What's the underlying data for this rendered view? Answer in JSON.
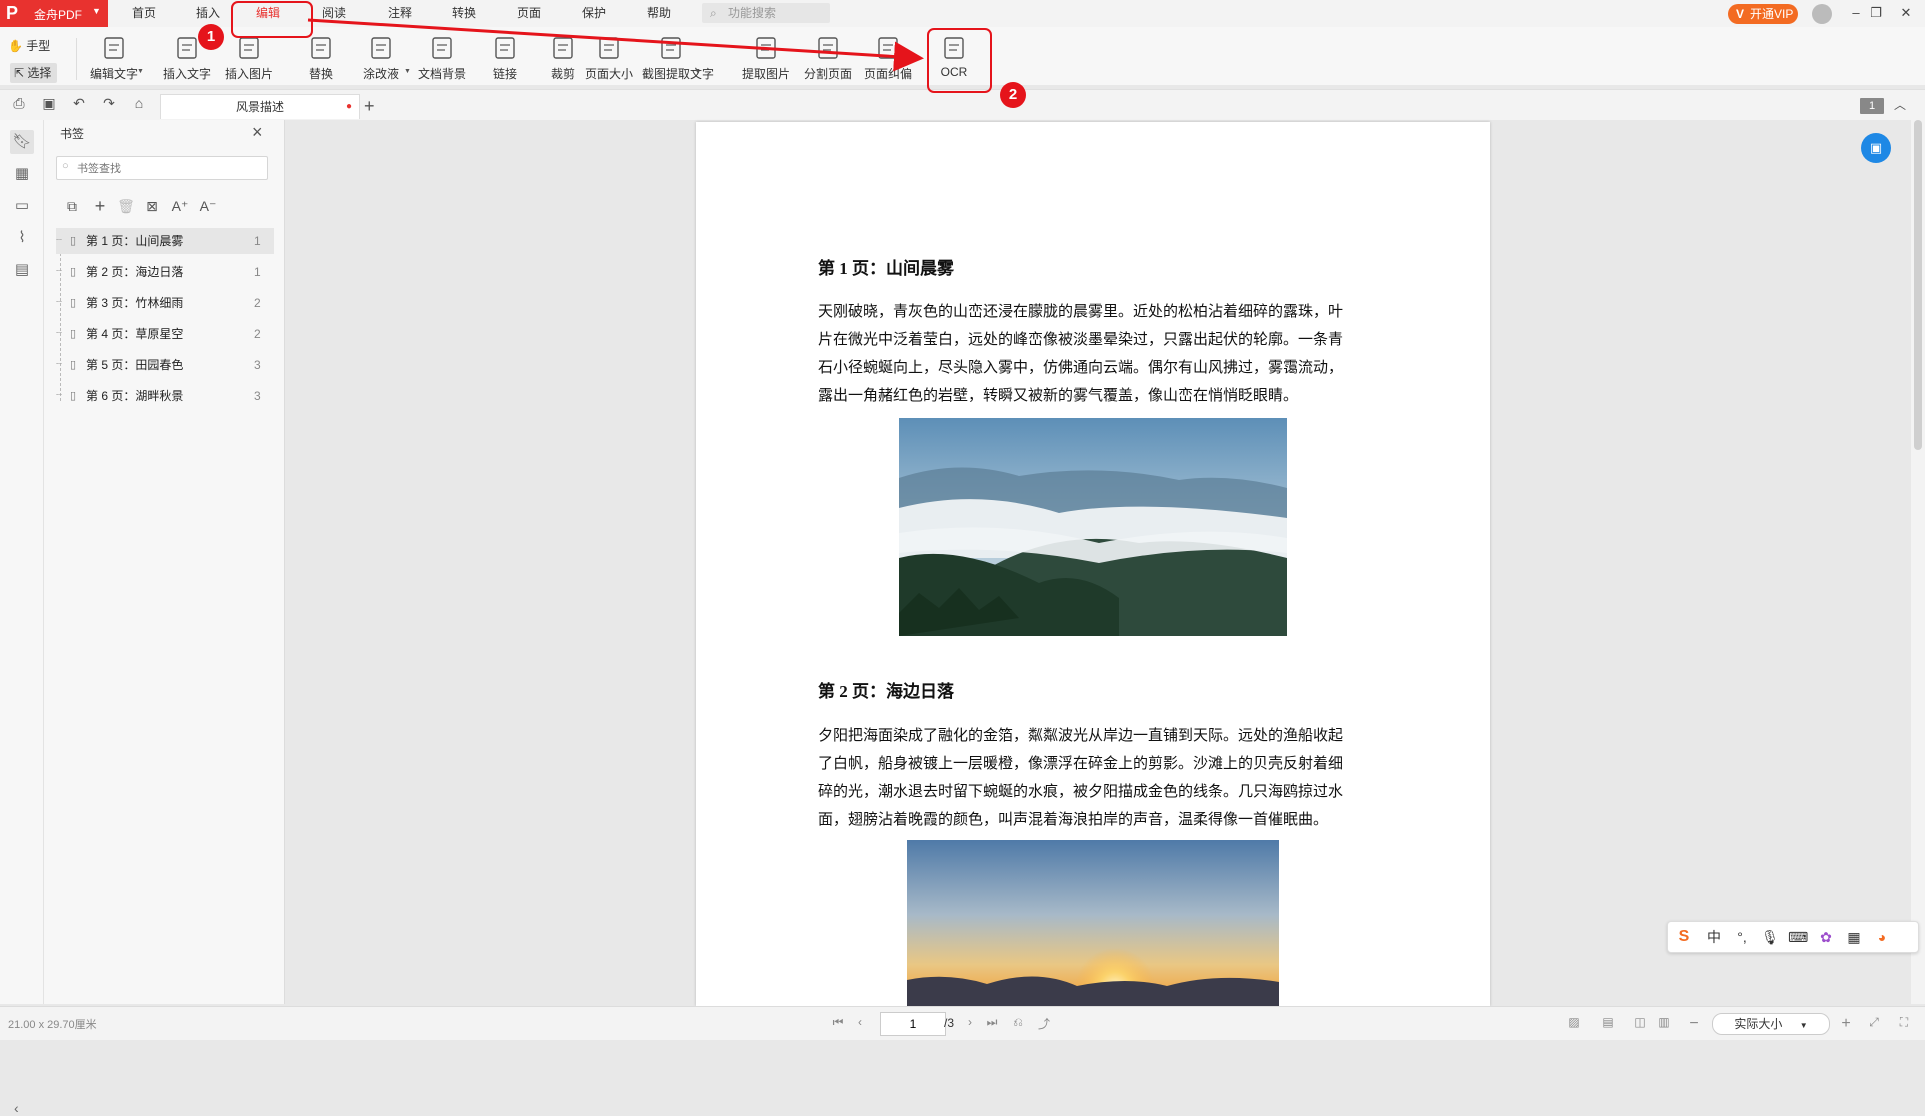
{
  "app": {
    "name": "金舟PDF"
  },
  "menu": {
    "items": [
      "首页",
      "插入",
      "编辑",
      "阅读",
      "注释",
      "转换",
      "页面",
      "保护",
      "帮助"
    ],
    "active_index": 2,
    "search_placeholder": "功能搜索"
  },
  "topright": {
    "vip_label": "开通VIP",
    "vip_badge": "V"
  },
  "modes": {
    "hand": "手型",
    "select": "选择"
  },
  "tools": [
    {
      "label": "编辑文字",
      "dropdown": true,
      "icon": "edit-text-icon"
    },
    {
      "label": "插入文字",
      "dropdown": false,
      "icon": "insert-text-icon"
    },
    {
      "label": "插入图片",
      "dropdown": false,
      "icon": "insert-image-icon"
    },
    {
      "label": "替换",
      "dropdown": false,
      "icon": "replace-icon"
    },
    {
      "label": "涂改液",
      "dropdown": true,
      "icon": "whiteout-icon"
    },
    {
      "label": "文档背景",
      "dropdown": false,
      "icon": "doc-background-icon"
    },
    {
      "label": "链接",
      "dropdown": false,
      "icon": "link-icon"
    },
    {
      "label": "裁剪",
      "dropdown": false,
      "icon": "crop-icon"
    },
    {
      "label": "页面大小",
      "dropdown": false,
      "icon": "page-size-icon"
    },
    {
      "label": "截图提取文字",
      "dropdown": true,
      "icon": "screenshot-text-icon"
    },
    {
      "label": "提取图片",
      "dropdown": false,
      "icon": "extract-image-icon"
    },
    {
      "label": "分割页面",
      "dropdown": false,
      "icon": "split-page-icon"
    },
    {
      "label": "页面纠偏",
      "dropdown": false,
      "icon": "deskew-icon"
    },
    {
      "label": "OCR",
      "dropdown": false,
      "icon": "ocr-icon"
    }
  ],
  "tab": {
    "title": "风景描述",
    "page_badge": "1"
  },
  "bookmarks": {
    "title": "书签",
    "search_placeholder": "书签查找",
    "items": [
      {
        "label": "第 1 页：山间晨雾",
        "page": "1",
        "selected": true
      },
      {
        "label": "第 2 页：海边日落",
        "page": "1",
        "selected": false
      },
      {
        "label": "第 3 页：竹林细雨",
        "page": "2",
        "selected": false
      },
      {
        "label": "第 4 页：草原星空",
        "page": "2",
        "selected": false
      },
      {
        "label": "第 5 页：田园春色",
        "page": "3",
        "selected": false
      },
      {
        "label": "第 6 页：湖畔秋景",
        "page": "3",
        "selected": false
      }
    ]
  },
  "document": {
    "sections": [
      {
        "heading": "第  1  页：山间晨雾",
        "lines": [
          "天刚破晓，青灰色的山峦还浸在朦胧的晨雾里。近处的松柏沾着细碎的露珠，叶",
          "片在微光中泛着莹白，远处的峰峦像被淡墨晕染过，只露出起伏的轮廓。一条青",
          "石小径蜿蜒向上，尽头隐入雾中，仿佛通向云端。偶尔有山风拂过，雾霭流动，",
          "露出一角赭红色的岩壁，转瞬又被新的雾气覆盖，像山峦在悄悄眨眼睛。"
        ]
      },
      {
        "heading": "第  2  页：海边日落",
        "lines": [
          "夕阳把海面染成了融化的金箔，粼粼波光从岸边一直铺到天际。远处的渔船收起",
          "了白帆，船身被镀上一层暖橙，像漂浮在碎金上的剪影。沙滩上的贝壳反射着细",
          "碎的光，潮水退去时留下蜿蜒的水痕，被夕阳描成金色的线条。几只海鸥掠过水",
          "面，翅膀沾着晚霞的颜色，叫声混着海浪拍岸的声音，温柔得像一首催眠曲。"
        ]
      }
    ]
  },
  "status": {
    "page_size": "21.00 x 29.70厘米",
    "current_page": "1",
    "total_pages": "/3",
    "zoom": "实际大小"
  },
  "ime": {
    "mode_label": "中"
  },
  "annotations": {
    "callout_1": "1",
    "callout_2": "2"
  },
  "colors": {
    "brand": "#e8322f",
    "annotation": "#e5141b",
    "vip": "#f36b22",
    "float": "#1e88e5"
  }
}
